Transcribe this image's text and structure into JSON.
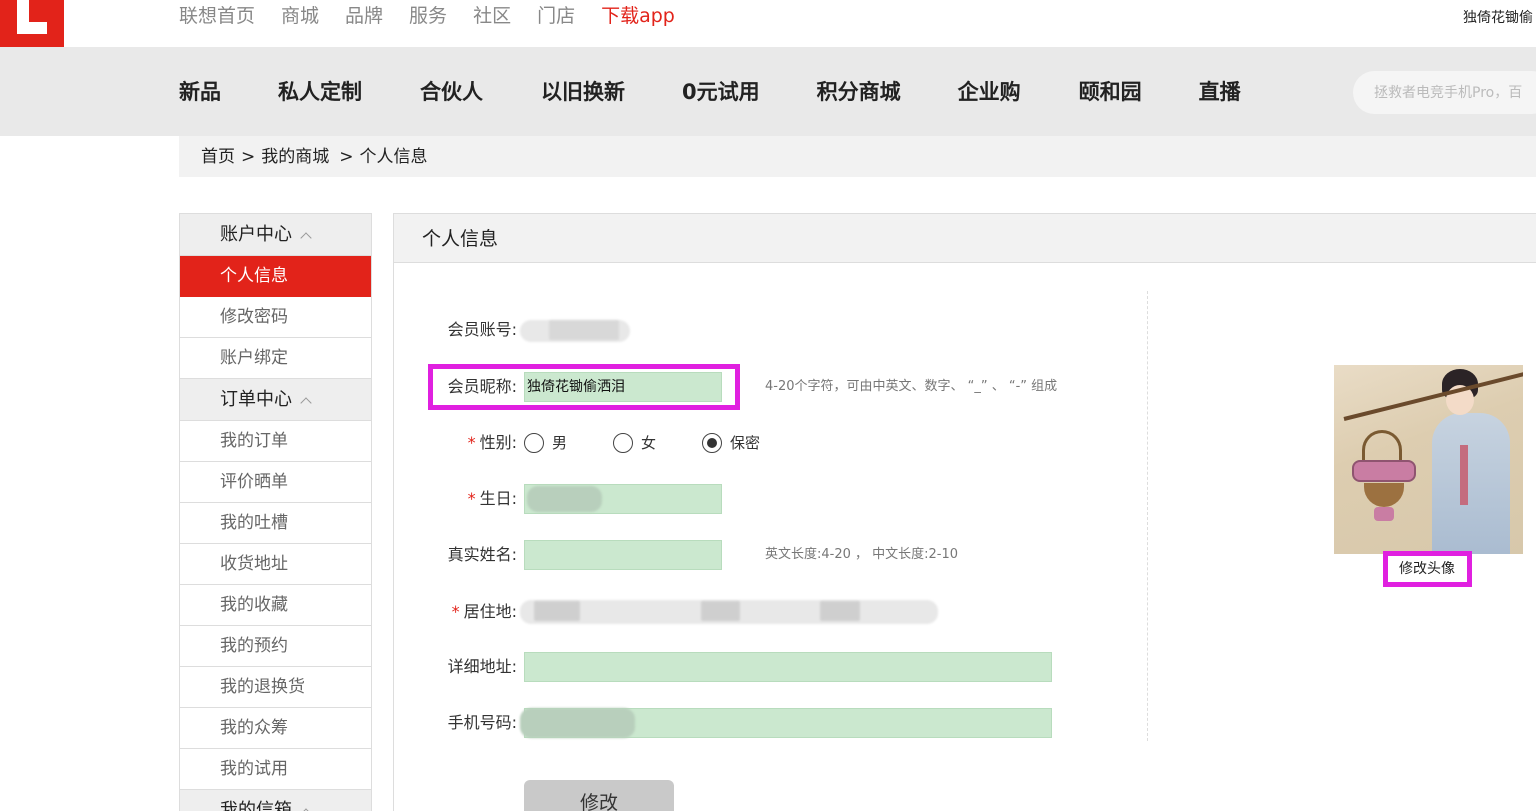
{
  "top_links": [
    "联想首页",
    "商城",
    "品牌",
    "服务",
    "社区",
    "门店",
    "下载app"
  ],
  "top_user": "独倚花锄偷",
  "nav_items": [
    "新品",
    "私人定制",
    "合伙人",
    "以旧换新",
    "0元试用",
    "积分商城",
    "企业购",
    "颐和园",
    "直播"
  ],
  "search": {
    "placeholder": "拯救者电竞手机Pro，百"
  },
  "breadcrumb": [
    "首页",
    ">",
    "我的商城",
    ">",
    "个人信息"
  ],
  "sidebar": {
    "groups": [
      {
        "title": "账户中心",
        "items": [
          "个人信息",
          "修改密码",
          "账户绑定"
        ],
        "active_index": 0
      },
      {
        "title": "订单中心",
        "items": [
          "我的订单",
          "评价晒单",
          "我的吐槽",
          "收货地址",
          "我的收藏",
          "我的预约",
          "我的退换货",
          "我的众筹",
          "我的试用"
        ]
      },
      {
        "title": "我的信箱",
        "items": []
      }
    ]
  },
  "panel": {
    "title": "个人信息",
    "fields": {
      "account_label": "会员账号:",
      "nickname_label": "会员昵称:",
      "nickname_value": "独倚花锄偷洒泪",
      "nickname_hint": "4-20个字符，可由中英文、数字、 “_” 、 “-” 组成",
      "gender_label": "性别:",
      "gender_options": [
        "男",
        "女",
        "保密"
      ],
      "gender_selected": "保密",
      "birthday_label": "生日:",
      "realname_label": "真实姓名:",
      "realname_hint": "英文长度:4-20 ， 中文长度:2-10",
      "residence_label": "居住地:",
      "address_label": "详细地址:",
      "phone_label": "手机号码:",
      "required_mark": "*"
    },
    "submit_label": "修改",
    "avatar_button": "修改头像"
  },
  "colors": {
    "brand_red": "#e2231a",
    "highlight": "#e020e0",
    "field_green": "#cbe8cf"
  }
}
